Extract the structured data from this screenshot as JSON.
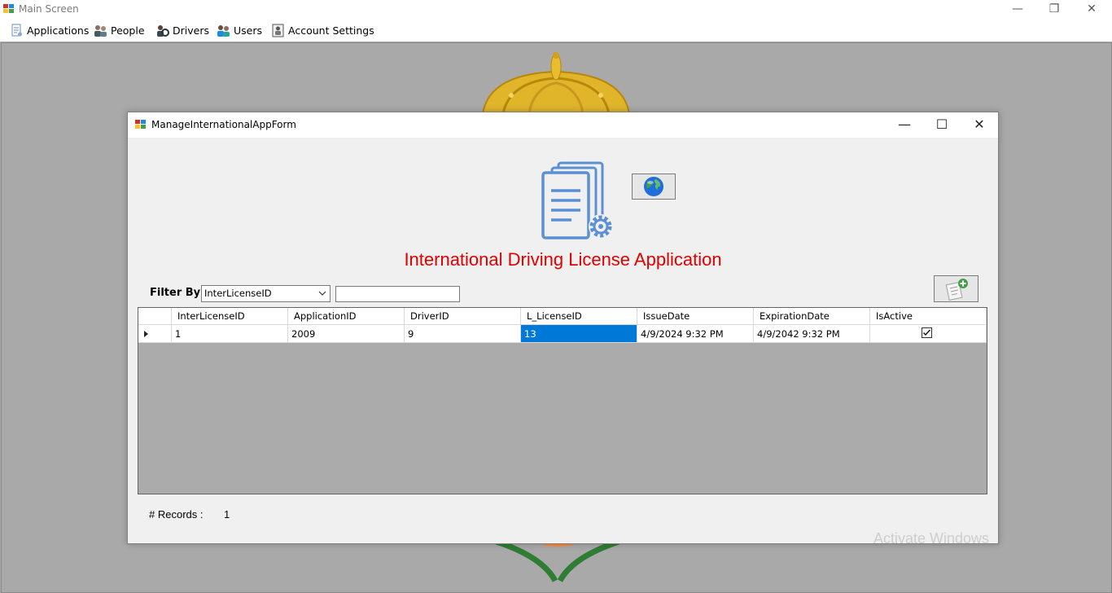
{
  "main_window": {
    "title": "Main Screen",
    "controls": {
      "minimize": "—",
      "restore": "❐",
      "close": "✕"
    }
  },
  "menu": {
    "items": [
      {
        "label": "Applications",
        "icon": "applications-icon"
      },
      {
        "label": "People",
        "icon": "people-icon"
      },
      {
        "label": "Drivers",
        "icon": "drivers-icon"
      },
      {
        "label": "Users",
        "icon": "users-icon"
      },
      {
        "label": "Account Settings",
        "icon": "account-settings-icon"
      }
    ]
  },
  "dialog": {
    "title": "ManageInternationalAppForm",
    "controls": {
      "minimize": "—",
      "maximize": "☐",
      "close": "✕"
    },
    "heading": "International Driving License Application",
    "heading_color": "#e00000",
    "filter": {
      "label": "Filter By :",
      "selected": "InterLicenseID",
      "value": ""
    },
    "grid": {
      "columns": [
        "InterLicenseID",
        "ApplicationID",
        "DriverID",
        "L_LicenseID",
        "IssueDate",
        "ExpirationDate",
        "IsActive"
      ],
      "rows": [
        {
          "InterLicenseID": "1",
          "ApplicationID": "2009",
          "DriverID": "9",
          "L_LicenseID": "13",
          "IssueDate": "4/9/2024 9:32 PM",
          "ExpirationDate": "4/9/2042 9:32 PM",
          "IsActive": true
        }
      ],
      "selection_color": "#0078d7"
    },
    "records": {
      "label": "# Records :",
      "value": "1"
    }
  },
  "watermark": "Activate Windows"
}
